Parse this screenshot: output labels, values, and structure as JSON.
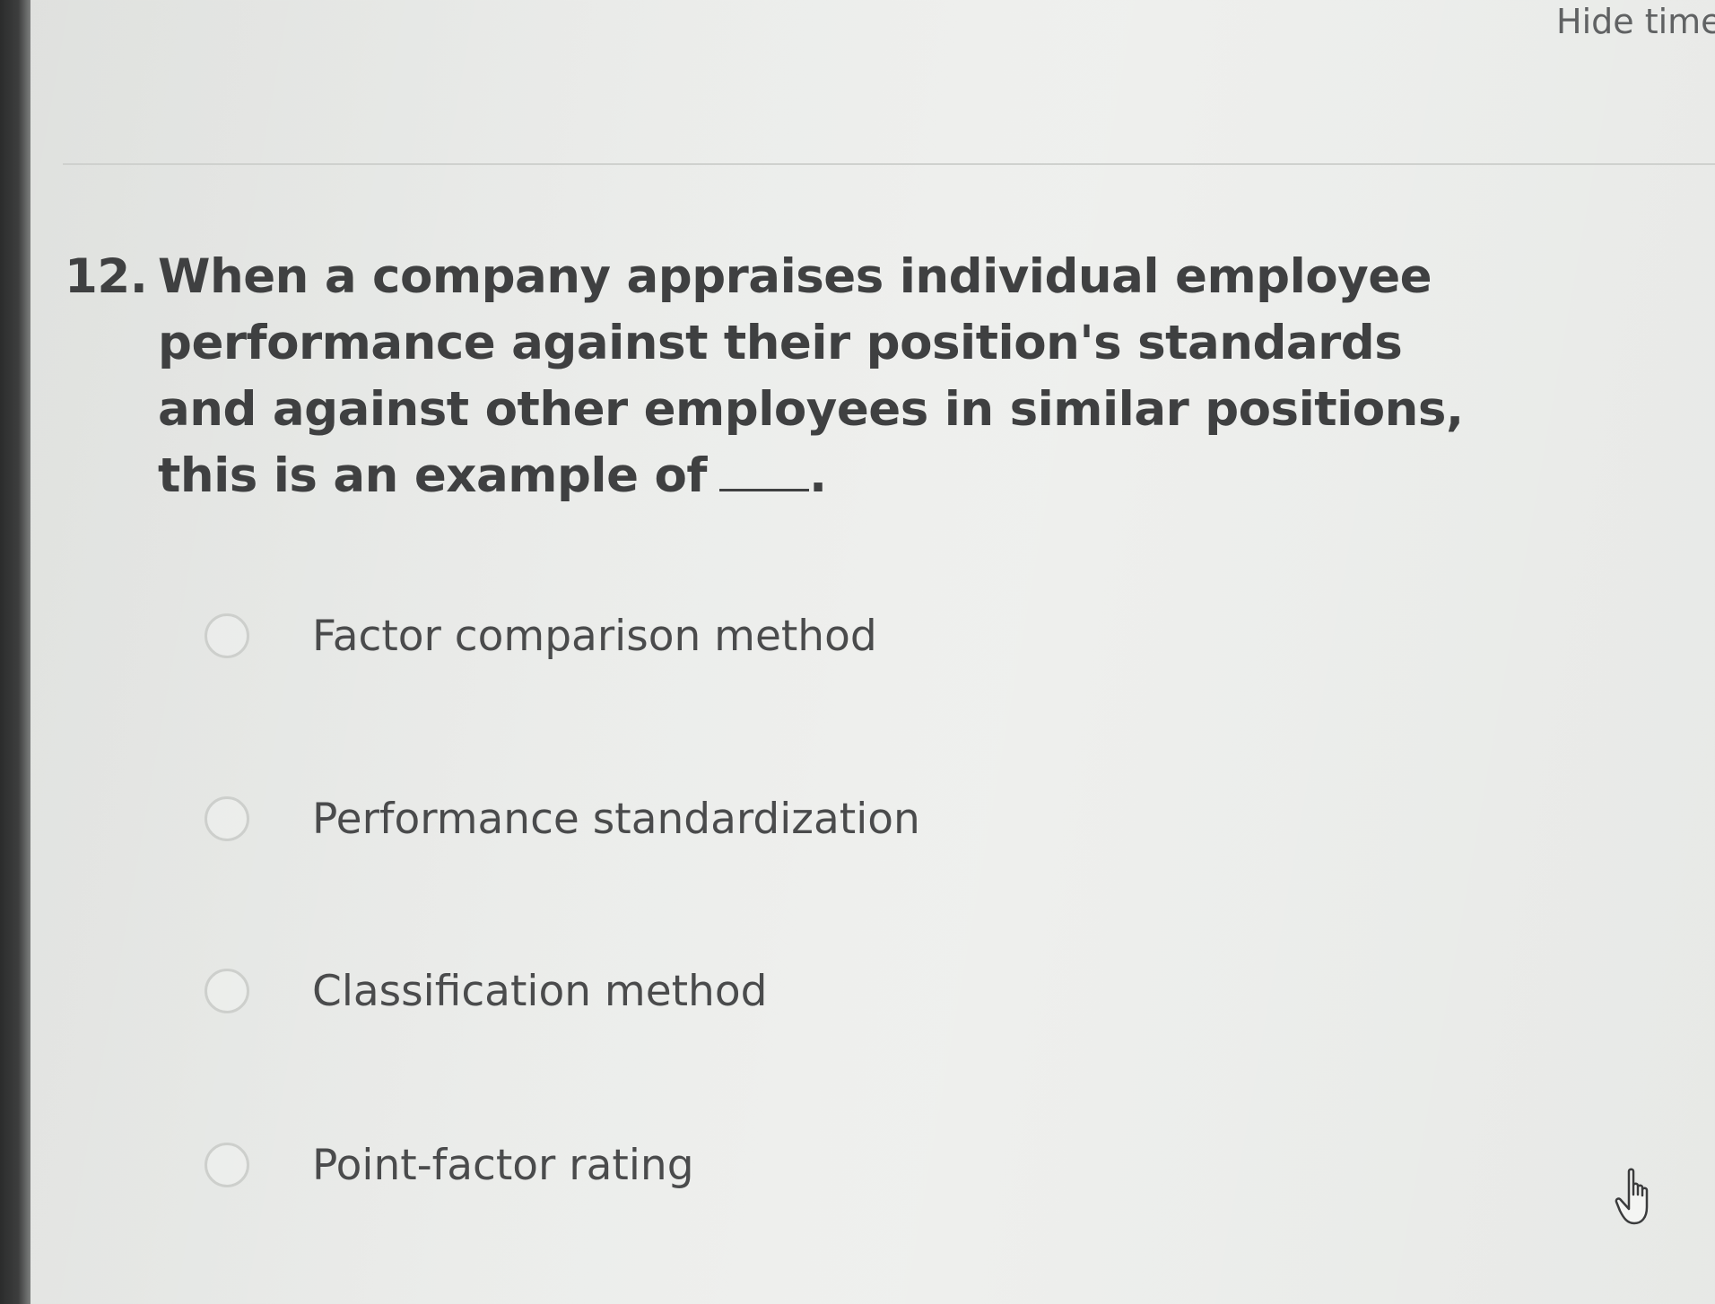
{
  "header": {
    "hide_timer_label": "Hide timer"
  },
  "question": {
    "number": "12.",
    "text": "When a company appraises individual employee performance against their position's standards and against other employees in similar positions, this is an example of",
    "after_blank": "."
  },
  "options": [
    {
      "label": "Factor comparison method",
      "selected": false
    },
    {
      "label": "Performance standardization",
      "selected": false
    },
    {
      "label": "Classification method",
      "selected": false
    },
    {
      "label": "Point-factor rating",
      "selected": false
    }
  ],
  "cursor": {
    "icon": "hand-pointer-icon"
  }
}
